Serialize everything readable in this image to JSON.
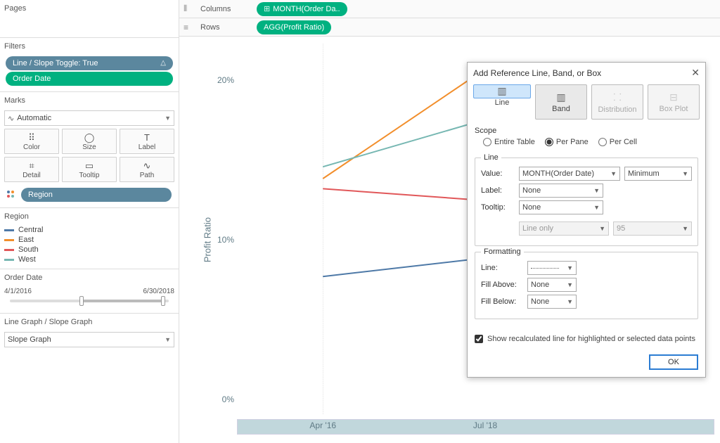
{
  "shelves": {
    "columns_label": "Columns",
    "rows_label": "Rows",
    "columns_pill": "MONTH(Order Da..",
    "rows_pill": "AGG(Profit Ratio)"
  },
  "pages": {
    "title": "Pages"
  },
  "filters": {
    "title": "Filters",
    "items": [
      {
        "label": "Line / Slope Toggle: True",
        "color": "blue",
        "glyph": "△"
      },
      {
        "label": "Order Date",
        "color": "teal",
        "glyph": ""
      }
    ]
  },
  "marks": {
    "title": "Marks",
    "type": "Automatic",
    "cards": [
      {
        "icon": "⠿",
        "label": "Color"
      },
      {
        "icon": "◯",
        "label": "Size"
      },
      {
        "icon": "T",
        "label": "Label"
      },
      {
        "icon": "⌗",
        "label": "Detail"
      },
      {
        "icon": "▭",
        "label": "Tooltip"
      },
      {
        "icon": "∿",
        "label": "Path"
      }
    ],
    "region_pill": "Region"
  },
  "legend": {
    "title": "Region",
    "items": [
      {
        "label": "Central",
        "color": "#4e79a7"
      },
      {
        "label": "East",
        "color": "#f28e2b"
      },
      {
        "label": "South",
        "color": "#e15759"
      },
      {
        "label": "West",
        "color": "#76b7b2"
      }
    ]
  },
  "order_date": {
    "title": "Order Date",
    "from": "4/1/2016",
    "to": "6/30/2018"
  },
  "param": {
    "title": "Line Graph / Slope Graph",
    "value": "Slope Graph"
  },
  "chart_data": {
    "type": "line",
    "ylabel": "Profit Ratio",
    "y_ticks": [
      "0%",
      "10%",
      "20%"
    ],
    "y_tick_vals": [
      0,
      10,
      20
    ],
    "ylim": [
      0,
      22
    ],
    "categories": [
      "Apr '16",
      "Jul '18"
    ],
    "series": [
      {
        "name": "Central",
        "color": "#4e79a7",
        "values": [
          8.2,
          9.3
        ]
      },
      {
        "name": "East",
        "color": "#f28e2b",
        "values": [
          14.0,
          20.5
        ]
      },
      {
        "name": "South",
        "color": "#e15759",
        "values": [
          13.4,
          12.7
        ]
      },
      {
        "name": "West",
        "color": "#76b7b2",
        "values": [
          14.7,
          17.5
        ]
      }
    ]
  },
  "dialog": {
    "title": "Add Reference Line, Band, or Box",
    "tabs": [
      {
        "label": "Line",
        "state": "sel"
      },
      {
        "label": "Band",
        "state": "sel2"
      },
      {
        "label": "Distribution",
        "state": "dis"
      },
      {
        "label": "Box Plot",
        "state": "dis"
      }
    ],
    "scope": {
      "title": "Scope",
      "options": [
        "Entire Table",
        "Per Pane",
        "Per Cell"
      ],
      "selected": "Per Pane"
    },
    "line_group": {
      "title": "Line",
      "value_label": "Value:",
      "value_field": "MONTH(Order Date)",
      "value_agg": "Minimum",
      "label_label": "Label:",
      "label_value": "None",
      "tooltip_label": "Tooltip:",
      "tooltip_value": "None",
      "type_value": "Line only",
      "conf_value": "95"
    },
    "formatting": {
      "title": "Formatting",
      "line_label": "Line:",
      "fill_above_label": "Fill Above:",
      "fill_above_value": "None",
      "fill_below_label": "Fill Below:",
      "fill_below_value": "None"
    },
    "checkbox_label": "Show recalculated line for highlighted or selected data points",
    "ok": "OK"
  }
}
